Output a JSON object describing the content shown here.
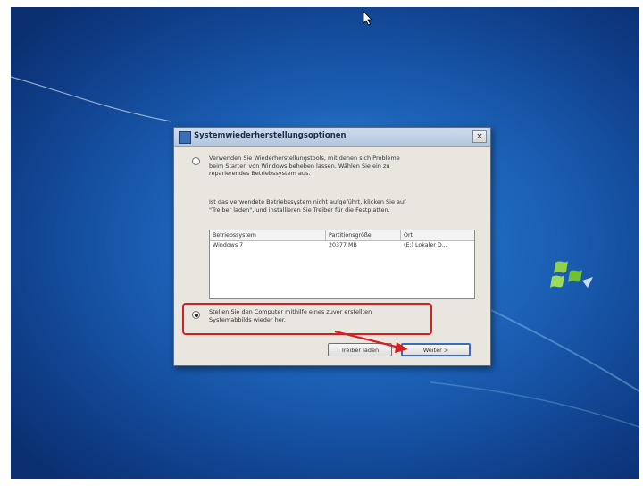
{
  "dialog": {
    "title": "Systemwiederherstellungsoptionen",
    "close_glyph": "×",
    "option1_line1": "Verwenden Sie Wiederherstellungstools, mit denen sich Probleme",
    "option1_line2": "beim Starten von Windows beheben lassen. Wählen Sie ein zu",
    "option1_line3": "reparierendes Betriebssystem aus.",
    "info_line1": "Ist das verwendete Betriebssystem nicht aufgeführt, klicken Sie auf",
    "info_line2": "\"Treiber laden\", und installieren Sie Treiber für die Festplatten.",
    "table": {
      "headers": [
        "Betriebssystem",
        "Partitionsgröße",
        "Ort"
      ],
      "rows": [
        [
          "Windows 7",
          "20377 MB",
          "(E:) Lokaler D..."
        ]
      ]
    },
    "option2_line1": "Stellen Sie den Computer mithilfe eines zuvor erstellten",
    "option2_line2": "Systemabbilds wieder her.",
    "load_drivers_label": "Treiber laden",
    "next_label": "Weiter >"
  },
  "icons": {
    "cursor": "mouse-pointer-icon",
    "logo": "windows-flag-icon",
    "app": "system-recovery-icon"
  },
  "colors": {
    "highlight": "#d42020",
    "desktop": "#1b5fb4"
  }
}
